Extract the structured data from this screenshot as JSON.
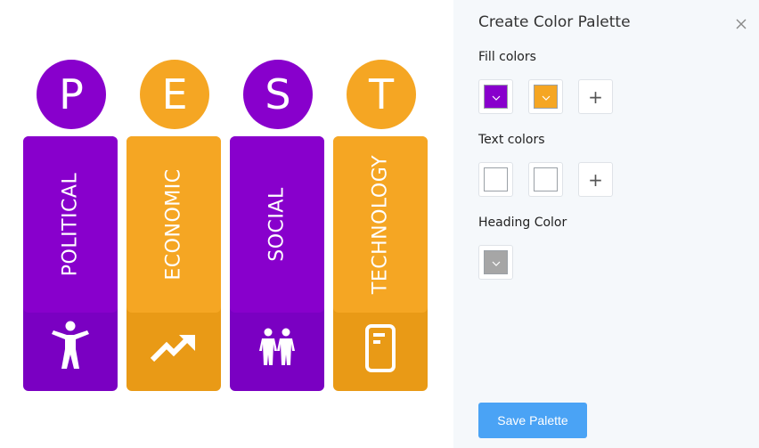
{
  "pest": [
    {
      "letter": "P",
      "label": "POLITICAL",
      "fill": "#8800cc",
      "dark": "#7a00c2",
      "icon": "accessibility-person-icon"
    },
    {
      "letter": "E",
      "label": "ECONOMIC",
      "fill": "#f5a623",
      "dark": "#e99a16",
      "icon": "trending-up-icon"
    },
    {
      "letter": "S",
      "label": "SOCIAL",
      "fill": "#8800cc",
      "dark": "#7a00c2",
      "icon": "people-icon"
    },
    {
      "letter": "T",
      "label": "TECHNOLOGY",
      "fill": "#f5a623",
      "dark": "#e99a16",
      "icon": "tablet-icon"
    }
  ],
  "panel": {
    "title": "Create Color Palette",
    "fill_colors_label": "Fill colors",
    "fill_colors": [
      "#8800cc",
      "#f5a623"
    ],
    "text_colors_label": "Text colors",
    "text_colors": [
      "#ffffff",
      "#ffffff"
    ],
    "heading_color_label": "Heading Color",
    "heading_color": "#a6a6a6",
    "add_symbol": "+",
    "save_label": "Save Palette"
  }
}
